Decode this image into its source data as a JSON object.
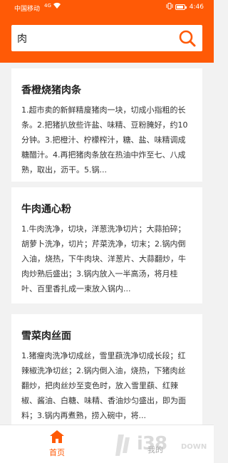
{
  "status_bar": {
    "carrier": "中国移动",
    "signal": "4G",
    "time": "4:46",
    "vibrate_icon": "vibrate-icon",
    "battery_icon": "battery-icon"
  },
  "search": {
    "value": "肉",
    "icon": "search-icon"
  },
  "colors": {
    "accent": "#ff5a06",
    "background": "#f2f2f2"
  },
  "recipes": [
    {
      "title": "香橙烧猪肉条",
      "body": "1.超市卖的新鲜精廋猪肉一块，切成小指粗的长条。2.把猪扒放些许盐、味精、豆粉腌好，约10分钟。3.把橙汁、柠檬榨汁，糖、盐、味精调成糖醋汁。4.再把猪肉条放在热油中炸至七、八成熟，取出，沥干。5.锅..."
    },
    {
      "title": "牛肉通心粉",
      "body": "1.牛肉洗净，切块，洋葱洗净切片；大蒜拍碎；胡萝卜洗净，切片；芹菜洗净，切末；2.锅内倒入油，烧热，下牛肉块、洋葱片、大蒜翻炒，牛肉炒熟后盛出；3.锅内放入一半高汤，将月桂叶、百里香扎成一束放入锅内..."
    },
    {
      "title": "雪菜肉丝面",
      "body": "1.猪瘦肉洗净切成丝，雪里蕻洗净切成长段；红辣椒洗净切丝；2.锅内倒入油，烧热，下猪肉丝翻炒，把肉丝炒至变色时，放入雪里蕻、红辣椒、酱油、白糖、味精、香油炒匀盛出，即为面料；3.锅内再煮熟，捞入碗中，将..."
    }
  ],
  "bottom_nav": {
    "home_label": "首页",
    "home_icon": "home-icon",
    "second_label": "我的"
  },
  "watermark": {
    "big": "i38",
    "small": "DOWN"
  }
}
